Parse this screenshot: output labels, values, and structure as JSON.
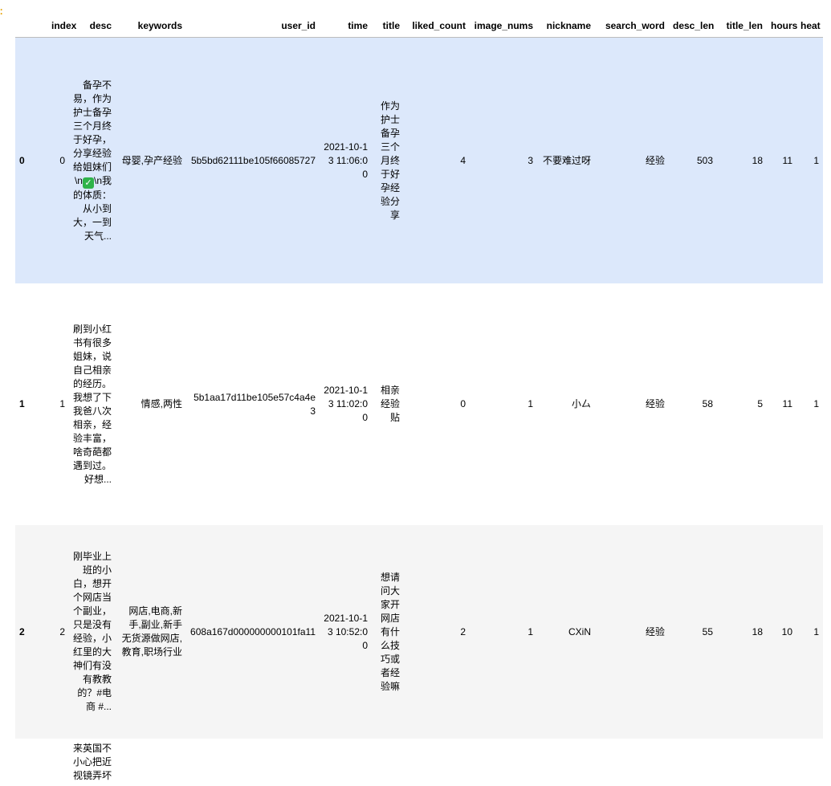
{
  "columns": [
    "",
    "index",
    "desc",
    "keywords",
    "user_id",
    "time",
    "title",
    "liked_count",
    "image_nums",
    "nickname",
    "search_word",
    "desc_len",
    "title_len",
    "hours",
    "heat"
  ],
  "rows": [
    {
      "label": "0",
      "index": "0",
      "desc_a": "备孕不易，作为护士备孕三个月终于好孕，分享经验给姐妹们\\n",
      "check_icon": "white-heavy-check-mark",
      "desc_b": "\\n我的体质：从小到大，一到天气...",
      "keywords": "母婴,孕产经验",
      "user_id": "5b5bd62111be105f66085727",
      "time": "2021-10-13 11:06:00",
      "title": "作为护士备孕三个月终于好孕经验分享",
      "liked_count": "4",
      "image_nums": "3",
      "nickname": "不要难过呀",
      "search_word": "经验",
      "desc_len": "503",
      "title_len": "18",
      "hours": "11",
      "heat": "1"
    },
    {
      "label": "1",
      "index": "1",
      "desc": "刷到小红书有很多姐妹，说自己相亲的经历。我想了下我爸八次相亲，经验丰富，啥奇葩都遇到过。好想...",
      "keywords": "情感,两性",
      "user_id": "5b1aa17d11be105e57c4a4e3",
      "time": "2021-10-13 11:02:00",
      "title": "相亲经验贴",
      "liked_count": "0",
      "image_nums": "1",
      "nickname": "小厶",
      "search_word": "经验",
      "desc_len": "58",
      "title_len": "5",
      "hours": "11",
      "heat": "1"
    },
    {
      "label": "2",
      "index": "2",
      "desc": "刚毕业上班的小白，想开个网店当个副业，只是没有经验，小红里的大神们有没有教教的？#电商 #...",
      "keywords": "网店,电商,新手,副业,新手无货源做网店,教育,职场行业",
      "user_id": "608a167d000000000101fa11",
      "time": "2021-10-13 10:52:00",
      "title": "想请问大家开网店有什么技巧或者经验嘛",
      "liked_count": "2",
      "image_nums": "1",
      "nickname": "CXiN",
      "search_word": "经验",
      "desc_len": "55",
      "title_len": "18",
      "hours": "10",
      "heat": "1"
    },
    {
      "desc": "来英国不小心把近视镜弄坏"
    }
  ]
}
